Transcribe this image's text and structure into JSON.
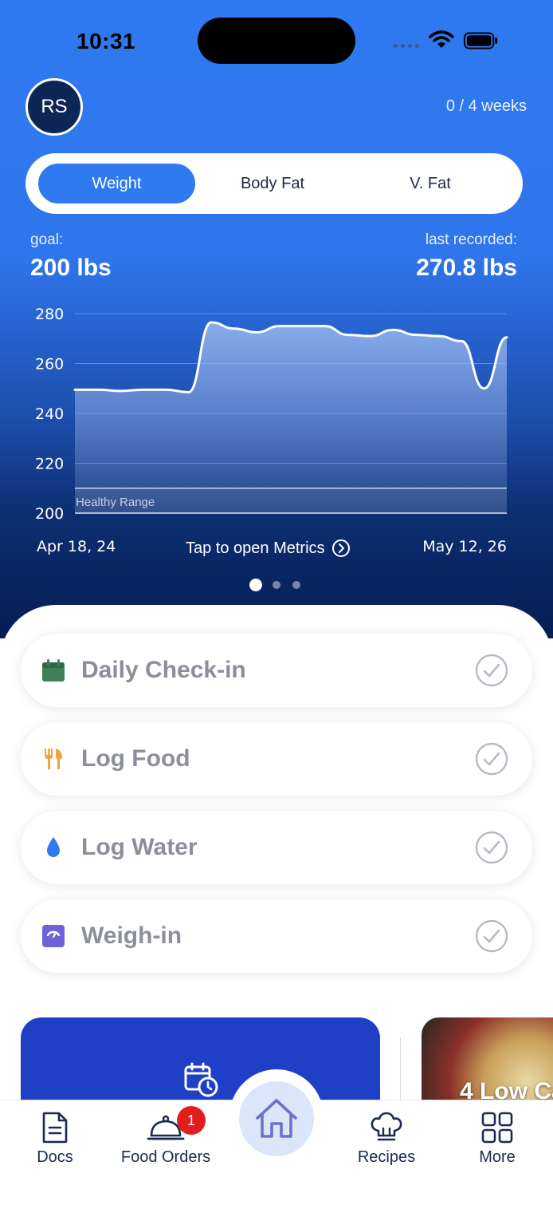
{
  "status_bar": {
    "time": "10:31"
  },
  "header": {
    "avatar_initials": "RS",
    "progress": "0 / 4 weeks"
  },
  "metric_tabs": [
    {
      "label": "Weight",
      "selected": true
    },
    {
      "label": "Body Fat",
      "selected": false
    },
    {
      "label": "V. Fat",
      "selected": false
    }
  ],
  "stats": {
    "goal_label": "goal:",
    "goal_value": "200 lbs",
    "last_label": "last recorded:",
    "last_value": "270.8 lbs"
  },
  "chart_data": {
    "type": "area",
    "x": [
      "Apr 18, 24",
      "May 12, 26"
    ],
    "y_ticks": [
      280,
      260,
      240,
      220,
      200
    ],
    "ylim": [
      200,
      280
    ],
    "values": [
      249.5,
      249.5,
      249,
      249.5,
      249.5,
      248.5,
      276.5,
      274,
      272.5,
      275,
      275,
      275,
      271.5,
      271,
      273.5,
      271.5,
      271,
      269,
      250,
      270.5
    ],
    "band_label": "Healthy Range",
    "band": [
      200,
      210
    ],
    "grid": true
  },
  "chart_footer": {
    "start_date": "Apr 18, 24",
    "end_date": "May 12, 26",
    "link": "Tap to open Metrics"
  },
  "pager": {
    "count": 3,
    "active": 0
  },
  "tasks": [
    {
      "label": "Daily Check-in",
      "icon": "calendar-icon",
      "color": "#3f7f5a"
    },
    {
      "label": "Log Food",
      "icon": "fork-knife-icon",
      "color": "#f2a33a"
    },
    {
      "label": "Log Water",
      "icon": "water-drop-icon",
      "color": "#2f7af0"
    },
    {
      "label": "Weigh-in",
      "icon": "scale-icon",
      "color": "#6c63d9"
    }
  ],
  "recipe_card": {
    "title": "4 Low Ca"
  },
  "tabbar": {
    "docs": "Docs",
    "food_orders": "Food Orders",
    "food_orders_badge": "1",
    "recipes": "Recipes",
    "more": "More"
  },
  "colors": {
    "primary": "#2f7af0",
    "navy": "#0c2656",
    "badge": "#e11d1d"
  }
}
